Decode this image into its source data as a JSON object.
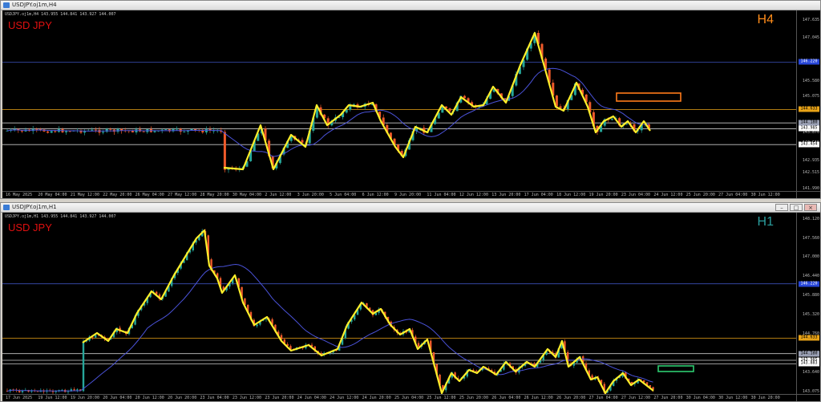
{
  "theme": {
    "bull": "#26a69a",
    "bear": "#ef5a2a",
    "zigzag": "#ffef2a",
    "ma": "#4a52d8",
    "resistance_line": "#e8a317",
    "level_line": "#3b4fb8",
    "h4_box": "#ff7a1a",
    "h1_box": "#2ecc71",
    "symbol_color": "#e01010",
    "h4_label_color": "#ff8c1a",
    "h1_label_color": "#2a9d9d"
  },
  "h4": {
    "window_title": "USDJPY.oj1m,H4",
    "ohlc": "USDJPY.oj1m,H4  143.955 144.841 143.927 144.007",
    "symbol": "USD JPY",
    "timeframe": "H4",
    "price_labels": [
      "147.635",
      "147.045",
      "146.165",
      "145.580",
      "145.075",
      "144.605",
      "144.165",
      "143.870",
      "143.515",
      "142.935",
      "142.515",
      "141.990"
    ],
    "tags": [
      {
        "text": "146.220",
        "bg": "#2746d8",
        "fg": "#ffffff",
        "price": 146.22
      },
      {
        "text": "144.633",
        "bg": "#e8a317",
        "fg": "#000000",
        "price": 144.633
      },
      {
        "text": "144.180",
        "bg": "#9aa0b4",
        "fg": "#000000",
        "price": 144.18
      },
      {
        "text": "143.985",
        "bg": "#ffffff",
        "fg": "#000000",
        "price": 143.985
      },
      {
        "text": "143.454",
        "bg": "#ffffff",
        "fg": "#000000",
        "price": 143.454
      }
    ],
    "time_labels": [
      "16 May 2025",
      "20 May 04:00",
      "21 May 12:00",
      "22 May 20:00",
      "26 May 04:00",
      "27 May 12:00",
      "28 May 20:00",
      "30 May 04:00",
      "2 Jun 12:00",
      "3 Jun 20:00",
      "5 Jun 04:00",
      "6 Jun 12:00",
      "9 Jun 20:00",
      "11 Jun 04:00",
      "12 Jun 12:00",
      "13 Jun 20:00",
      "17 Jun 04:00",
      "18 Jun 12:00",
      "19 Jun 20:00",
      "23 Jun 04:00",
      "24 Jun 12:00",
      "25 Jun 20:00",
      "27 Jun 04:00",
      "30 Jun 12:00"
    ],
    "price_range": [
      141.9,
      147.95
    ]
  },
  "h1": {
    "window_title": "USDJPY.oj1m,H1",
    "ohlc": "USDJPY.oj1m,H1  143.955 144.841 143.927 144.007",
    "symbol": "USD JPY",
    "timeframe": "H1",
    "price_labels": [
      "148.120",
      "147.560",
      "147.000",
      "146.440",
      "145.880",
      "145.320",
      "144.760",
      "144.200",
      "143.640",
      "143.075"
    ],
    "tags": [
      {
        "text": "146.220",
        "bg": "#2746d8",
        "fg": "#ffffff",
        "price": 146.22
      },
      {
        "text": "144.633",
        "bg": "#e8a317",
        "fg": "#000000",
        "price": 144.633
      },
      {
        "text": "144.180",
        "bg": "#9aa0b4",
        "fg": "#000000",
        "price": 144.18
      },
      {
        "text": "143.985",
        "bg": "#ffffff",
        "fg": "#000000",
        "price": 143.985
      },
      {
        "text": "143.883",
        "bg": "#ffffff",
        "fg": "#000000",
        "price": 143.883
      }
    ],
    "time_labels": [
      "17 Jun 2025",
      "19 Jun 12:00",
      "19 Jun 20:00",
      "20 Jun 04:00",
      "20 Jun 12:00",
      "20 Jun 20:00",
      "23 Jun 04:00",
      "23 Jun 12:00",
      "23 Jun 20:00",
      "24 Jun 04:00",
      "24 Jun 12:00",
      "24 Jun 20:00",
      "25 Jun 04:00",
      "25 Jun 12:00",
      "25 Jun 20:00",
      "26 Jun 04:00",
      "26 Jun 12:00",
      "26 Jun 20:00",
      "27 Jun 04:00",
      "27 Jun 12:00",
      "27 Jun 20:00",
      "30 Jun 04:00",
      "30 Jun 12:00",
      "30 Jun 20:00"
    ],
    "price_range": [
      143.0,
      148.3
    ]
  }
}
